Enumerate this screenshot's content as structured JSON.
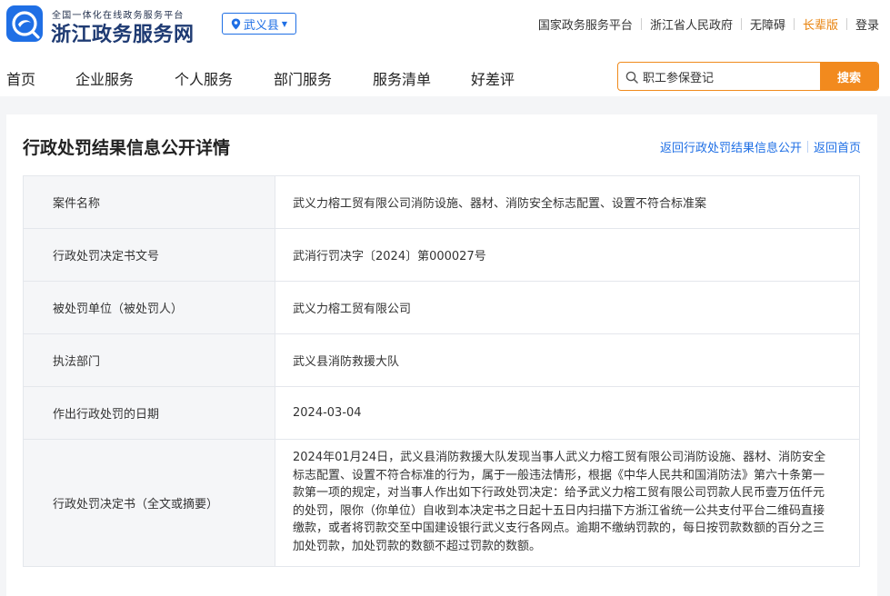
{
  "header": {
    "logo_tagline": "全国一体化在线政务服务平台",
    "logo_title": "浙江政务服务网",
    "region": "武义县",
    "top_links": [
      "国家政务服务平台",
      "浙江省人民政府",
      "无障碍",
      "长辈版",
      "登录"
    ],
    "accent_color": "#1f6fe5",
    "elder_color": "#e8820c"
  },
  "nav": {
    "items": [
      "首页",
      "企业服务",
      "个人服务",
      "部门服务",
      "服务清单",
      "好差评"
    ]
  },
  "search": {
    "value": "职工参保登记",
    "button_label": "搜索",
    "button_color": "#f28a1e"
  },
  "detail": {
    "title": "行政处罚结果信息公开详情",
    "links": [
      "返回行政处罚结果信息公开",
      "返回首页"
    ],
    "rows": [
      {
        "label": "案件名称",
        "value": "武义力榕工贸有限公司消防设施、器材、消防安全标志配置、设置不符合标准案"
      },
      {
        "label": "行政处罚决定书文号",
        "value": "武消行罚决字〔2024〕第000027号"
      },
      {
        "label": "被处罚单位（被处罚人）",
        "value": "武义力榕工贸有限公司"
      },
      {
        "label": "执法部门",
        "value": "武义县消防救援大队"
      },
      {
        "label": "作出行政处罚的日期",
        "value": "2024-03-04"
      },
      {
        "label": "行政处罚决定书（全文或摘要）",
        "value": "2024年01月24日，武义县消防救援大队发现当事人武义力榕工贸有限公司消防设施、器材、消防安全标志配置、设置不符合标准的行为，属于一般违法情形，根据《中华人民共和国消防法》第六十条第一款第一项的规定，对当事人作出如下行政处罚决定：给予武义力榕工贸有限公司罚款人民币壹万伍仟元的处罚，限你（你单位）自收到本决定书之日起十五日内扫描下方浙江省统一公共支付平台二维码直接缴款，或者将罚款交至中国建设银行武义支行各网点。逾期不缴纳罚款的，每日按罚款数额的百分之三加处罚款，加处罚款的数额不超过罚款的数额。"
      }
    ]
  }
}
